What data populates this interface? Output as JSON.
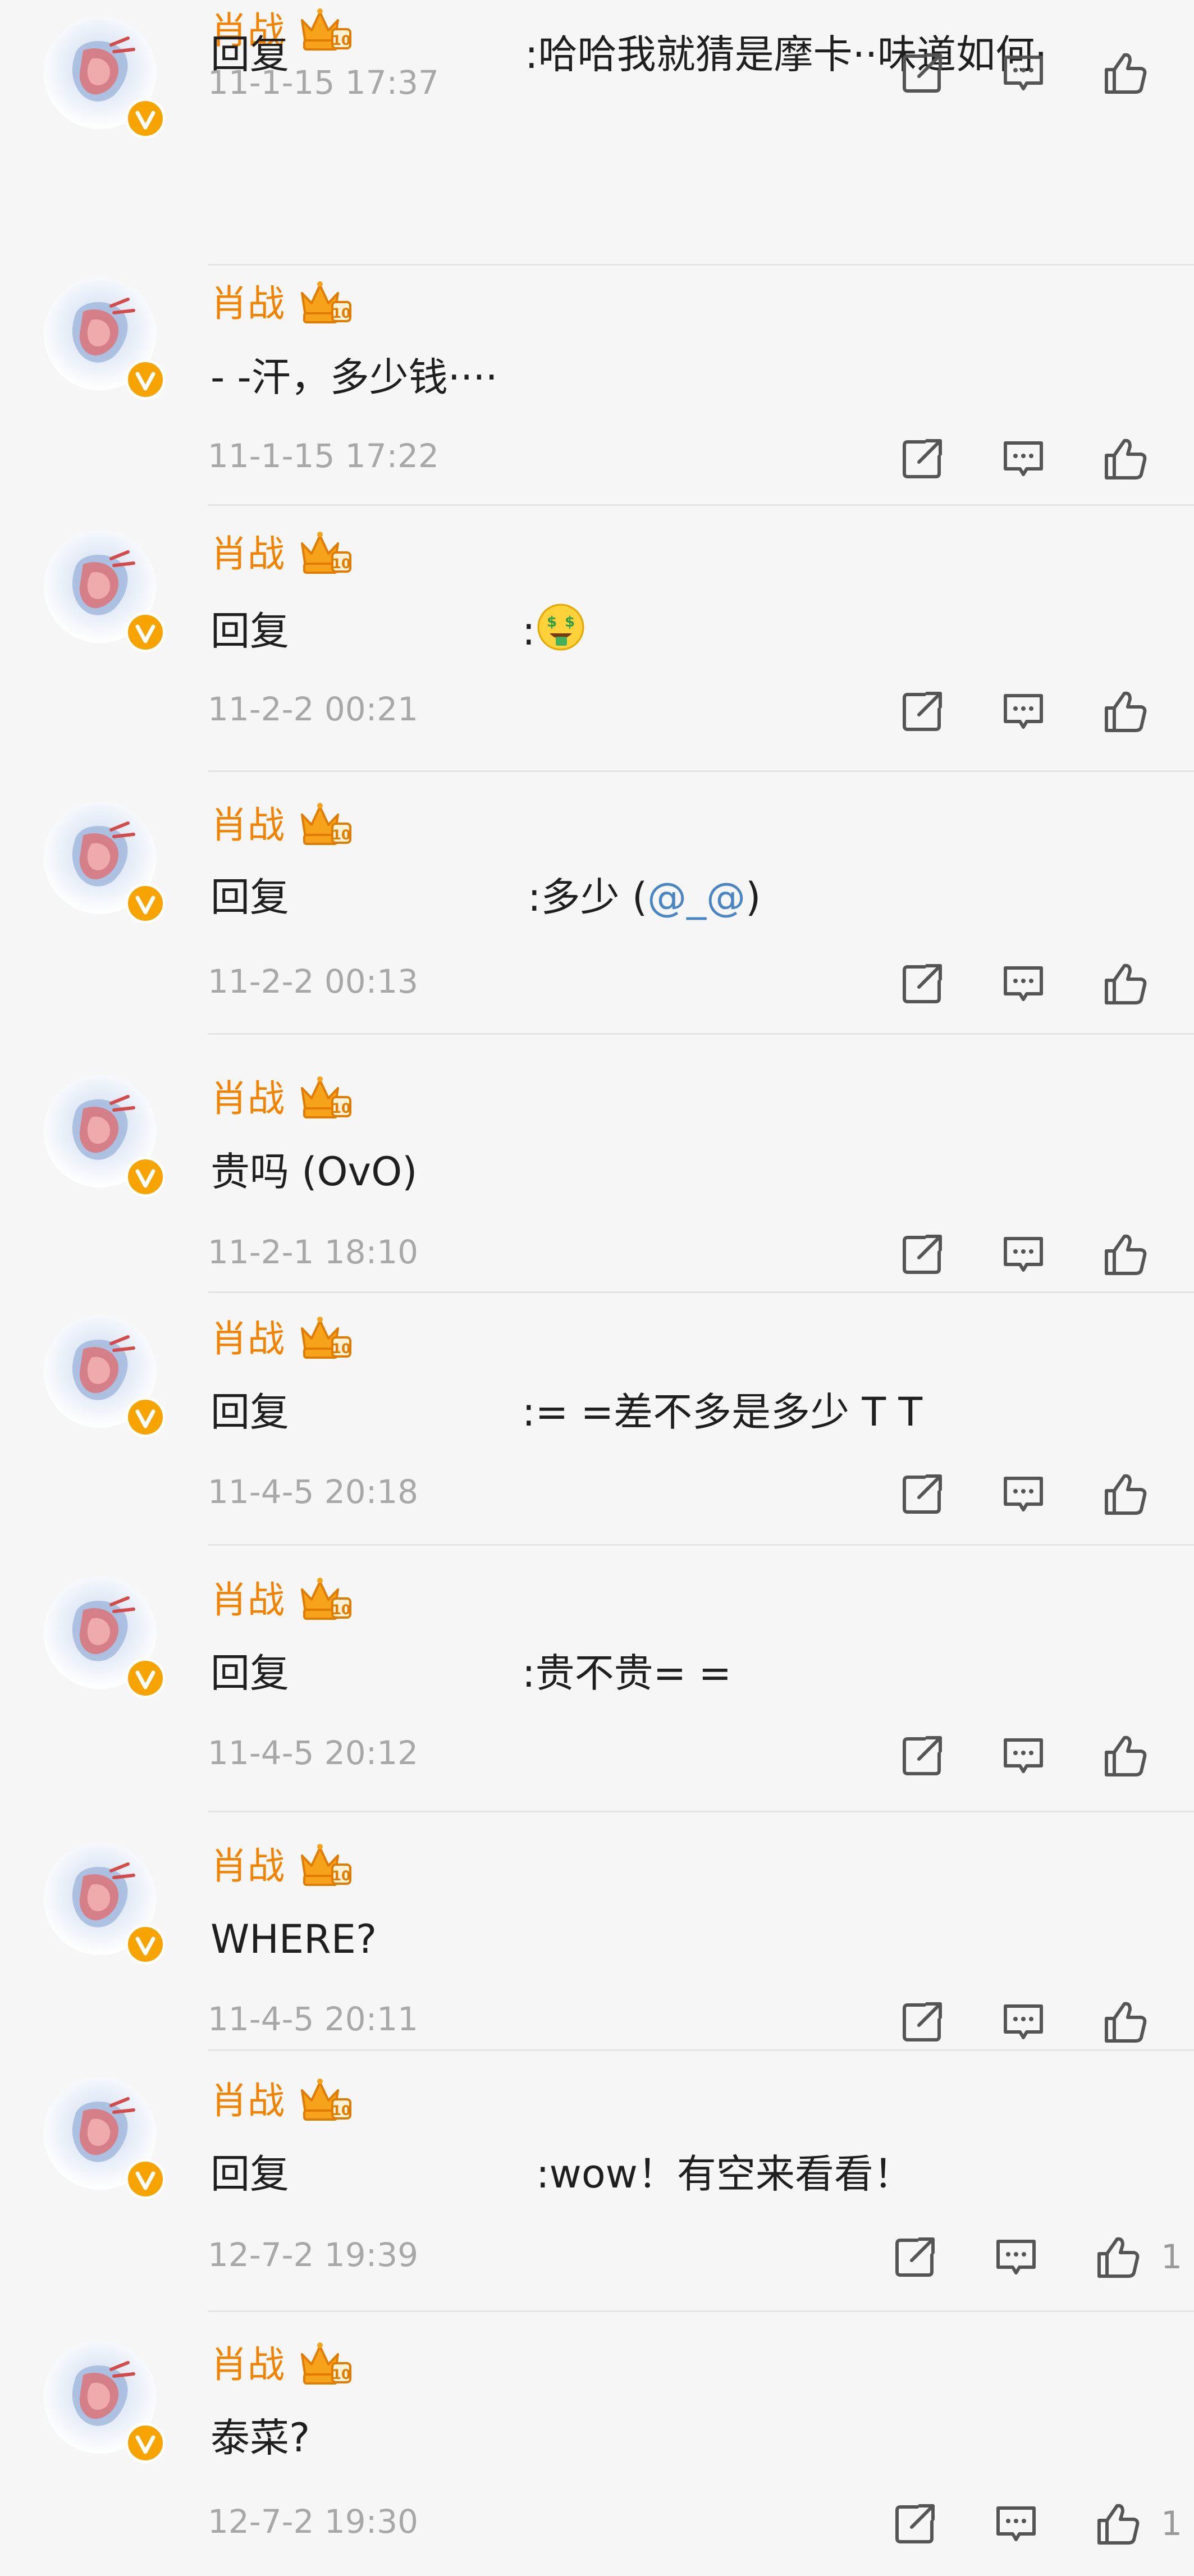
{
  "comments": [
    {
      "name": "肖战",
      "reply_prefix": "回复",
      "text": ":哈哈我就猜是摩卡··味道如何·",
      "time": "11-1-15 17:37",
      "likes": ""
    },
    {
      "name": "肖战",
      "reply_prefix": "",
      "text": "- -汗，多少钱····",
      "time": "11-1-15 17:22",
      "likes": ""
    },
    {
      "name": "肖战",
      "reply_prefix": "回复",
      "text": ":",
      "emoji": "money-mouth-face",
      "time": "11-2-2 00:21",
      "likes": ""
    },
    {
      "name": "肖战",
      "reply_prefix": "回复",
      "text": ":多少",
      "text_suffix": "(",
      "mention": "@_@",
      "text_end": ")",
      "time": "11-2-2 00:13",
      "likes": ""
    },
    {
      "name": "肖战",
      "reply_prefix": "",
      "text": "贵吗 (OvO)",
      "time": "11-2-1 18:10",
      "likes": ""
    },
    {
      "name": "肖战",
      "reply_prefix": "回复",
      "text": ":= =差不多是多少 T T",
      "time": "11-4-5 20:18",
      "likes": ""
    },
    {
      "name": "肖战",
      "reply_prefix": "回复",
      "text": ":贵不贵= =",
      "time": "11-4-5 20:12",
      "likes": ""
    },
    {
      "name": "肖战",
      "reply_prefix": "",
      "text": "WHERE?",
      "time": "11-4-5 20:11",
      "likes": ""
    },
    {
      "name": "肖战",
      "reply_prefix": "回复",
      "text": ":wow！有空来看看！",
      "time": "12-7-2 19:39",
      "likes": "1"
    },
    {
      "name": "肖战",
      "reply_prefix": "",
      "text": "泰菜?",
      "time": "12-7-2 19:30",
      "likes": "1"
    }
  ],
  "icons": {
    "share": "share-icon",
    "comment": "comment-icon",
    "like": "like-icon",
    "verified": "verified-badge-icon",
    "vip": "vip-crown-icon"
  },
  "colors": {
    "name": "#f38200",
    "verified": "#f7a300",
    "mention": "#4a86c6",
    "time": "#a8a8a8"
  }
}
